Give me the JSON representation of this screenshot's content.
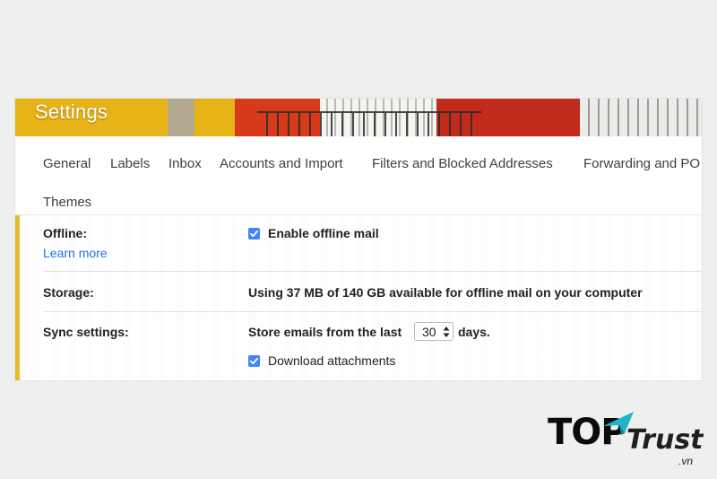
{
  "header": {
    "title": "Settings"
  },
  "tabs": [
    {
      "label": "General"
    },
    {
      "label": "Labels"
    },
    {
      "label": "Inbox"
    },
    {
      "label": "Accounts and Import"
    },
    {
      "label": "Filters and Blocked Addresses"
    },
    {
      "label": "Forwarding and PO"
    },
    {
      "label": "Themes"
    }
  ],
  "offline": {
    "label": "Offline:",
    "learn_more": "Learn more",
    "enable_label": "Enable offline mail",
    "enable_checked": true
  },
  "storage": {
    "label": "Storage:",
    "text": "Using 37 MB of 140 GB available for offline mail on your computer"
  },
  "sync": {
    "label": "Sync settings:",
    "prefix": "Store emails from the last",
    "days_value": "30",
    "suffix": "days.",
    "download_label": "Download attachments",
    "download_checked": true
  },
  "watermark": {
    "brand": "TOP",
    "brand2": "Trust",
    "domain": ".vn",
    "colors": {
      "brand": "#0b0b0b",
      "accent": "#1fb6c9"
    }
  },
  "colors": {
    "checkbox": "#4285f4",
    "link": "#1a73e8",
    "banner_yellow": "#e6b416",
    "banner_red": "#d63a1a"
  }
}
